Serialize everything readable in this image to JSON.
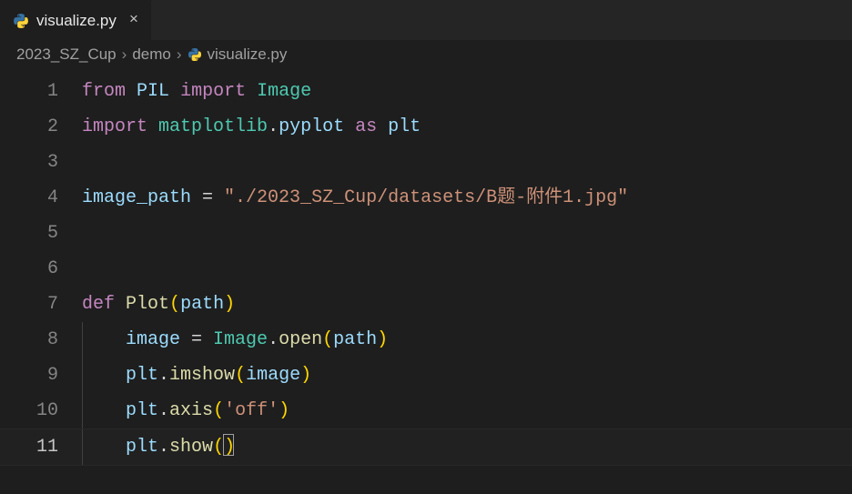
{
  "tab": {
    "filename": "visualize.py",
    "close_glyph": "×"
  },
  "breadcrumb": {
    "segments": [
      "2023_SZ_Cup",
      "demo",
      "visualize.py"
    ],
    "chevron": "›"
  },
  "gutter": {
    "1": "1",
    "2": "2",
    "3": "3",
    "4": "4",
    "5": "5",
    "6": "6",
    "7": "7",
    "8": "8",
    "9": "9",
    "10": "10",
    "11": "11"
  },
  "code": {
    "l1": {
      "from": "from",
      "pil": "PIL",
      "import": "import",
      "image": "Image"
    },
    "l2": {
      "import": "import",
      "mpl": "matplotlib",
      "dot": ".",
      "pyplot": "pyplot",
      "as": "as",
      "plt": "plt"
    },
    "l4": {
      "lhs": "image_path",
      "eq": " = ",
      "str": "\"./2023_SZ_Cup/datasets/B题-附件1.jpg\""
    },
    "l7": {
      "def": "def",
      "name": "Plot",
      "lp": "(",
      "arg": "path",
      "rp": ")"
    },
    "l8": {
      "lhs": "image",
      "eq": " = ",
      "cls": "Image",
      "dot": ".",
      "fn": "open",
      "lp": "(",
      "arg": "path",
      "rp": ")"
    },
    "l9": {
      "obj": "plt",
      "dot": ".",
      "fn": "imshow",
      "lp": "(",
      "arg": "image",
      "rp": ")"
    },
    "l10": {
      "obj": "plt",
      "dot": ".",
      "fn": "axis",
      "lp": "(",
      "str": "'off'",
      "rp": ")"
    },
    "l11": {
      "obj": "plt",
      "dot": ".",
      "fn": "show",
      "lp": "(",
      "rp": ")"
    }
  }
}
